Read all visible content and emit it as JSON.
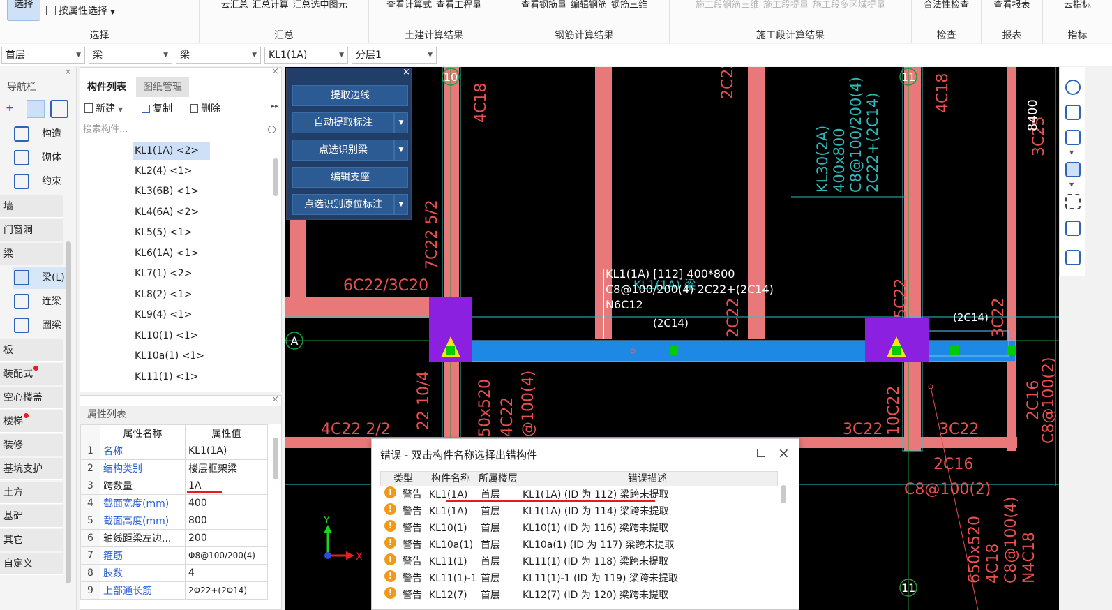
{
  "ribbon": {
    "select_btn": "选择",
    "prop_select": "按属性选择",
    "groups": [
      {
        "label": "选择"
      },
      {
        "label": "汇总",
        "btns": [
          "云汇总",
          "汇总计算",
          "汇总选中图元"
        ]
      },
      {
        "label": "土建计算结果",
        "btns": [
          "查看计算式",
          "查看工程量"
        ]
      },
      {
        "label": "钢筋计算结果",
        "btns": [
          "查看钢筋量",
          "编辑钢筋",
          "钢筋三维"
        ]
      },
      {
        "label": "施工段计算结果",
        "btns": [
          "施工段钢筋三维",
          "施工段提量",
          "施工段多区域提量"
        ]
      },
      {
        "label": "检查",
        "btns": [
          "合法性检查"
        ]
      },
      {
        "label": "报表",
        "btns": [
          "查看报表"
        ]
      },
      {
        "label": "指标",
        "btns": [
          "云指标"
        ]
      }
    ]
  },
  "selectors": [
    "首层",
    "梁",
    "梁",
    "KL1(1A)",
    "分层1"
  ],
  "nav": {
    "title": "导航栏",
    "top_items": [
      "构造",
      "砌体",
      "约束"
    ],
    "heads": [
      "墙",
      "门窗洞",
      "梁"
    ],
    "beam_items": [
      "梁(L)",
      "连梁",
      "圈梁"
    ],
    "more_heads": [
      "板",
      "装配式",
      "空心楼盖",
      "楼梯",
      "装修",
      "基坑支护",
      "土方",
      "基础",
      "其它",
      "自定义"
    ]
  },
  "complist": {
    "tab_active": "构件列表",
    "tab_other": "图纸管理",
    "new": "新建",
    "copy": "复制",
    "delete": "删除",
    "search_placeholder": "搜索构件...",
    "items": [
      "KL1(1A) <2>",
      "KL2(4) <1>",
      "KL3(6B) <1>",
      "KL4(6A) <2>",
      "KL5(5) <1>",
      "KL6(1A) <1>",
      "KL7(1) <2>",
      "KL8(2) <1>",
      "KL9(4) <1>",
      "KL10(1) <1>",
      "KL10a(1) <1>",
      "KL11(1) <1>"
    ]
  },
  "proplist": {
    "title": "属性列表",
    "col_name": "属性名称",
    "col_val": "属性值",
    "rows": [
      {
        "n": "1",
        "k": "名称",
        "v": "KL1(1A)"
      },
      {
        "n": "2",
        "k": "结构类别",
        "v": "楼层框架梁"
      },
      {
        "n": "3",
        "k": "跨数量",
        "v": "1A"
      },
      {
        "n": "4",
        "k": "截面宽度(mm)",
        "v": "400"
      },
      {
        "n": "5",
        "k": "截面高度(mm)",
        "v": "800"
      },
      {
        "n": "6",
        "k": "轴线距梁左边...",
        "v": "200"
      },
      {
        "n": "7",
        "k": "箍筋",
        "v": "Φ8@100/200(4)"
      },
      {
        "n": "8",
        "k": "肢数",
        "v": "4"
      },
      {
        "n": "9",
        "k": "上部通长筋",
        "v": "2Φ22+(2Φ14)"
      }
    ]
  },
  "floatpanel": {
    "btns": [
      "提取边线",
      "自动提取标注",
      "点选识别梁",
      "编辑支座",
      "点选识别原位标注"
    ]
  },
  "cad": {
    "axis_10": "10",
    "axis_11": "11",
    "axis_A": "A",
    "axis_11b": "11",
    "labels": [
      "4C18",
      "2C22",
      "KL30(2A)",
      "400x800",
      "C8@100/200(4)",
      "2C22+(2C14)",
      "4C18",
      "8400",
      "3C25",
      "6C22/3C20",
      "7C22 5/2",
      "2C22",
      "5C22",
      "(2C14)",
      "(2C14)",
      "4C22 2/2",
      "22 10/4",
      "50x520",
      "4C22",
      "@100(4)",
      "3C22",
      "10C22",
      "3C22",
      "2C16",
      "C8@100(2)",
      "2C16",
      "C8@100(2)",
      "650x520",
      "4C18",
      "C8@100(4)",
      "N4C18",
      "3C22"
    ],
    "beam_info": [
      "KL1(1A) [112] 400*800",
      "C8@100/200(4) 2C22+(2C14)",
      "N6C12"
    ],
    "beam_info_ghost": "KL1(1A) 梁",
    "axis_y": "Y",
    "axis_x": "X"
  },
  "errdlg": {
    "title": "错误 - 双击构件名称选择出错构件",
    "cols": [
      "类型",
      "构件名称",
      "所属楼层",
      "错误描述"
    ],
    "rows": [
      {
        "t": "警告",
        "name": "KL1(1A)",
        "floor": "首层",
        "desc": "KL1(1A) (ID 为 112) 梁跨未提取"
      },
      {
        "t": "警告",
        "name": "KL1(1A)",
        "floor": "首层",
        "desc": "KL1(1A) (ID 为 114) 梁跨未提取"
      },
      {
        "t": "警告",
        "name": "KL10(1)",
        "floor": "首层",
        "desc": "KL10(1) (ID 为 116) 梁跨未提取"
      },
      {
        "t": "警告",
        "name": "KL10a(1)",
        "floor": "首层",
        "desc": "KL10a(1) (ID 为 117) 梁跨未提取"
      },
      {
        "t": "警告",
        "name": "KL11(1)",
        "floor": "首层",
        "desc": "KL11(1) (ID 为 118) 梁跨未提取"
      },
      {
        "t": "警告",
        "name": "KL11(1)-1",
        "floor": "首层",
        "desc": "KL11(1)-1 (ID 为 119) 梁跨未提取"
      },
      {
        "t": "警告",
        "name": "KL12(7)",
        "floor": "首层",
        "desc": "KL12(7) (ID 为 120) 梁跨未提取"
      }
    ]
  }
}
